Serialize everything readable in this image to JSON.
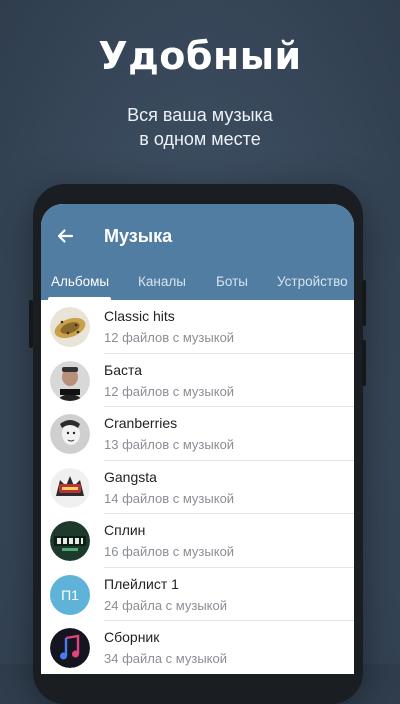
{
  "promo": {
    "title": "Удобный",
    "subtitle_line1": "Вся ваша музыка",
    "subtitle_line2": "в одном месте"
  },
  "appbar": {
    "back_icon": "arrow-left-icon",
    "title": "Музыка",
    "color": "#517da2"
  },
  "tabs": [
    {
      "label": "Альбомы",
      "active": true
    },
    {
      "label": "Каналы",
      "active": false
    },
    {
      "label": "Боты",
      "active": false
    },
    {
      "label": "Устройство",
      "active": false
    }
  ],
  "items": [
    {
      "name": "Classic hits",
      "meta": "12 файлов с музыкой"
    },
    {
      "name": "Баста",
      "meta": "12 файлов с музыкой"
    },
    {
      "name": "Cranberries",
      "meta": "13 файлов с музыкой"
    },
    {
      "name": "Gangsta",
      "meta": "14 файлов с музыкой"
    },
    {
      "name": "Сплин",
      "meta": "16 файлов с музыкой"
    },
    {
      "name": "Плейлист 1",
      "meta": "24 файла с музыкой",
      "avatar_text": "П1"
    },
    {
      "name": "Сборник",
      "meta": "34 файла с музыкой"
    }
  ]
}
